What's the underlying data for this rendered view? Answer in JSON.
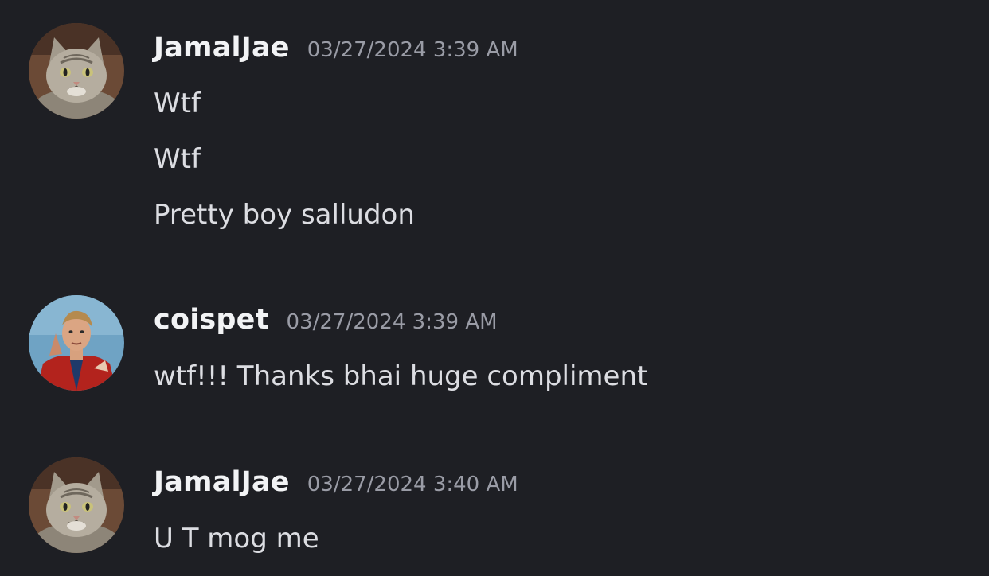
{
  "messages": [
    {
      "author": "JamalJae",
      "timestamp": "03/27/2024 3:39 AM",
      "avatar_icon": "cat-avatar-icon",
      "lines": [
        "Wtf",
        "Wtf",
        "Pretty boy salludon"
      ]
    },
    {
      "author": "coispet",
      "timestamp": "03/27/2024 3:39 AM",
      "avatar_icon": "man-red-jacket-avatar-icon",
      "lines": [
        "wtf!!! Thanks bhai huge compliment"
      ]
    },
    {
      "author": "JamalJae",
      "timestamp": "03/27/2024 3:40 AM",
      "avatar_icon": "cat-avatar-icon",
      "lines": [
        "U T mog me"
      ]
    }
  ],
  "colors": {
    "background": "#1e1f24",
    "username": "#f2f3f5",
    "timestamp": "#9a9ca6",
    "message_text": "#dcdde2"
  }
}
